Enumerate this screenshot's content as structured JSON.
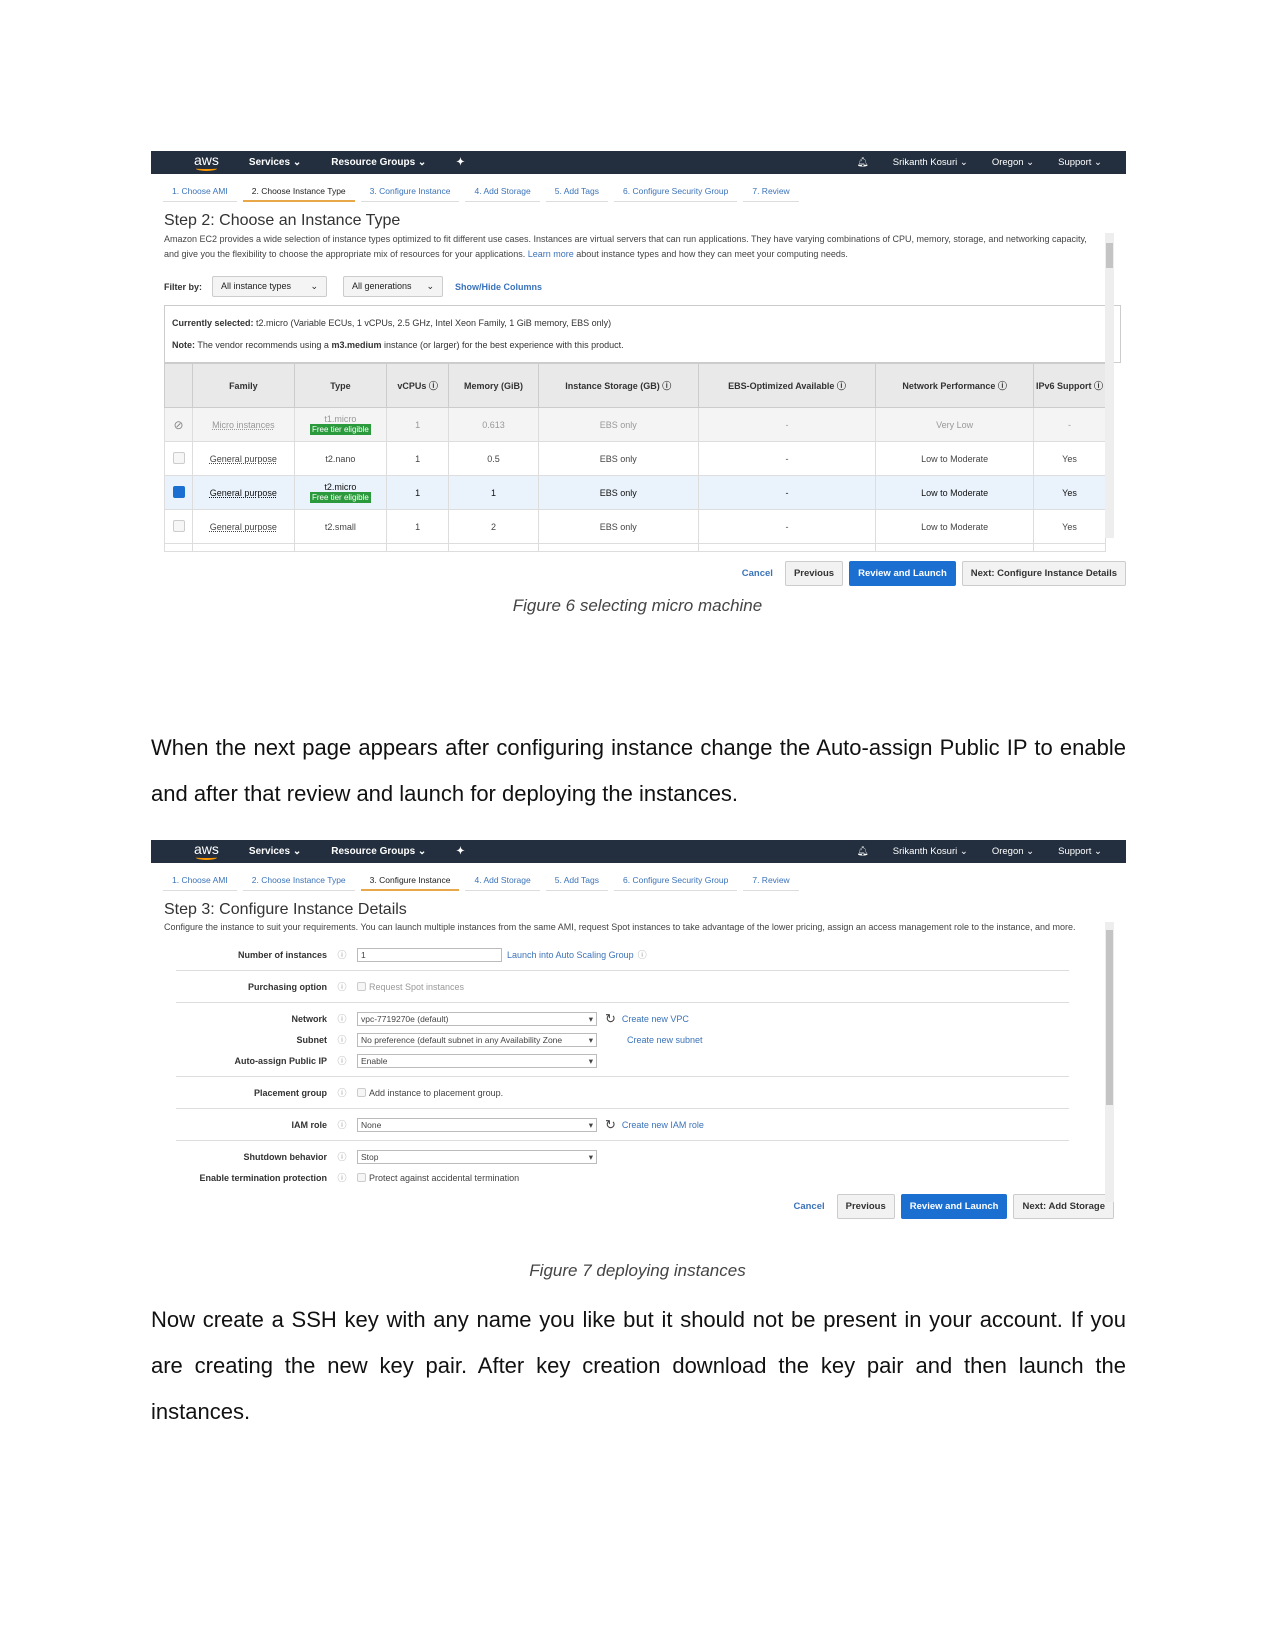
{
  "nav": {
    "logo": "aws",
    "services": "Services ⌄",
    "resource_groups": "Resource Groups ⌄",
    "user": "Srikanth Kosuri ⌄",
    "region": "Oregon ⌄",
    "support": "Support ⌄"
  },
  "wizard_tabs": [
    "1. Choose AMI",
    "2. Choose Instance Type",
    "3. Configure Instance",
    "4. Add Storage",
    "5. Add Tags",
    "6. Configure Security Group",
    "7. Review"
  ],
  "shot1": {
    "title": "Step 2: Choose an Instance Type",
    "desc_a": "Amazon EC2 provides a wide selection of instance types optimized to fit different use cases. Instances are virtual servers that can run applications. They have varying combinations of CPU, memory, storage, and networking capacity, and give you the flexibility to choose the appropriate mix of resources for your applications.",
    "learn_more": "Learn more",
    "desc_b": "about instance types and how they can meet your computing needs.",
    "filter_label": "Filter by:",
    "filter1": "All instance types",
    "filter2": "All generations",
    "show_hide": "Show/Hide Columns",
    "selected_label": "Currently selected:",
    "selected_value": "t2.micro (Variable ECUs, 1 vCPUs, 2.5 GHz, Intel Xeon Family, 1 GiB memory, EBS only)",
    "note_label": "Note:",
    "note_a": "The vendor recommends using a",
    "note_b": "m3.medium",
    "note_c": "instance (or larger) for the best experience with this product.",
    "columns": [
      "Family",
      "Type",
      "vCPUs ⓘ",
      "Memory (GiB)",
      "Instance Storage (GB) ⓘ",
      "EBS-Optimized Available ⓘ",
      "Network Performance ⓘ",
      "IPv6 Support ⓘ"
    ],
    "free_tier": "Free tier eligible",
    "rows": [
      {
        "state": "disabled",
        "family": "Micro instances",
        "type": "t1.micro",
        "free": true,
        "vcpus": "1",
        "memory": "0.613",
        "storage": "EBS only",
        "ebs": "-",
        "network": "Very Low",
        "ipv6": "-"
      },
      {
        "state": "unchecked",
        "family": "General purpose",
        "type": "t2.nano",
        "free": false,
        "vcpus": "1",
        "memory": "0.5",
        "storage": "EBS only",
        "ebs": "-",
        "network": "Low to Moderate",
        "ipv6": "Yes"
      },
      {
        "state": "checked",
        "family": "General purpose",
        "type": "t2.micro",
        "free": true,
        "vcpus": "1",
        "memory": "1",
        "storage": "EBS only",
        "ebs": "-",
        "network": "Low to Moderate",
        "ipv6": "Yes"
      },
      {
        "state": "unchecked",
        "family": "General purpose",
        "type": "t2.small",
        "free": false,
        "vcpus": "1",
        "memory": "2",
        "storage": "EBS only",
        "ebs": "-",
        "network": "Low to Moderate",
        "ipv6": "Yes"
      }
    ],
    "cancel": "Cancel",
    "previous": "Previous",
    "review": "Review and Launch",
    "next": "Next: Configure Instance Details"
  },
  "caption1": "Figure 6 selecting micro machine",
  "para1": "When the next page appears after configuring instance change the Auto-assign Public IP to enable and after that review and launch for deploying the instances.",
  "shot2": {
    "title": "Step 3: Configure Instance Details",
    "desc": "Configure the instance to suit your requirements. You can launch multiple instances from the same AMI, request Spot instances to take advantage of the lower pricing, assign an access management role to the instance, and more.",
    "num_label": "Number of instances",
    "num_value": "1",
    "asg_link": "Launch into Auto Scaling Group",
    "purch_label": "Purchasing option",
    "purch_value": "Request Spot instances",
    "network_label": "Network",
    "network_value": "vpc-7719270e (default)",
    "create_vpc": "Create new VPC",
    "subnet_label": "Subnet",
    "subnet_value": "No preference (default subnet in any Availability Zone",
    "create_subnet": "Create new subnet",
    "public_ip_label": "Auto-assign Public IP",
    "public_ip_value": "Enable",
    "placement_label": "Placement group",
    "placement_value": "Add instance to placement group.",
    "iam_label": "IAM role",
    "iam_value": "None",
    "create_iam": "Create new IAM role",
    "shutdown_label": "Shutdown behavior",
    "shutdown_value": "Stop",
    "term_label": "Enable termination protection",
    "term_value": "Protect against accidental termination",
    "cancel": "Cancel",
    "previous": "Previous",
    "review": "Review and Launch",
    "next": "Next: Add Storage"
  },
  "caption2": "Figure 7 deploying instances",
  "para2": "Now create a SSH key with any name you like but it should not be present in your account. If you are creating the new key pair. After key creation download the key pair and then launch the instances."
}
